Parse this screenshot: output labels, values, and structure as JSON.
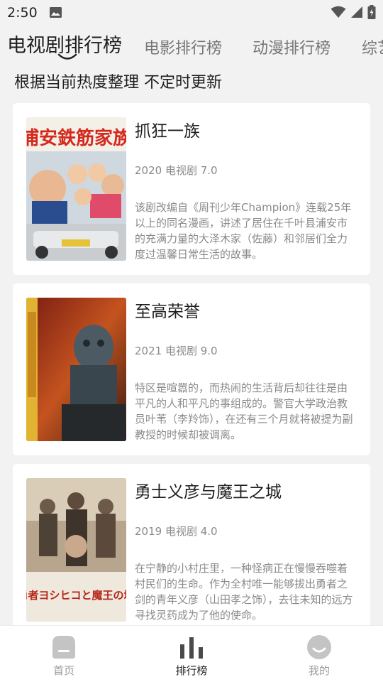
{
  "status_bar": {
    "time": "2:50"
  },
  "tabs": [
    {
      "label": "电视剧排行榜",
      "active": true
    },
    {
      "label": "电影排行榜",
      "active": false
    },
    {
      "label": "动漫排行榜",
      "active": false
    },
    {
      "label": "综艺",
      "active": false
    }
  ],
  "subtitle": "根据当前热度整理  不定时更新",
  "cards": [
    {
      "title": "抓狂一族",
      "meta": "2020 电视剧 7.0",
      "description": "该剧改编自《周刊少年Champion》连载25年以上的同名漫画，讲述了居住在千叶县浦安市的充满力量的大泽木家（佐藤）和邻居们全力度过温馨日常生活的故事。",
      "poster_text": "浦安鉄筋家族"
    },
    {
      "title": "至高荣誉",
      "meta": "2021 电视剧 9.0",
      "description": "特区是喧嚣的，而热闹的生活背后却往往是由平凡的人和平凡的事组成的。警官大学政治教员叶苇（李羚饰），在还有三个月就将被提为副教授的时候却被调离。"
    },
    {
      "title": "勇士义彦与魔王之城",
      "meta": "2019 电视剧 4.0",
      "description": "在宁静的小村庄里，一种怪病正在慢慢吞噬着村民们的生命。作为全村唯一能够拔出勇者之剑的青年义彦（山田孝之饰），去往未知的远方寻找灵药成为了他的使命。",
      "poster_text": "勇者ヨシヒコと魔王の城"
    }
  ],
  "bottom_nav": [
    {
      "label": "首页",
      "icon": "home-icon",
      "active": false
    },
    {
      "label": "排行榜",
      "icon": "ranking-icon",
      "active": true
    },
    {
      "label": "我的",
      "icon": "profile-icon",
      "active": false
    }
  ],
  "colors": {
    "background": "#f2f2f3",
    "card": "#ffffff",
    "text_primary": "#1e1e1e",
    "text_secondary": "#8a8a8a",
    "tab_inactive": "#777777",
    "nav_inactive": "#c4c4c4",
    "nav_active": "#4a4a4a"
  }
}
